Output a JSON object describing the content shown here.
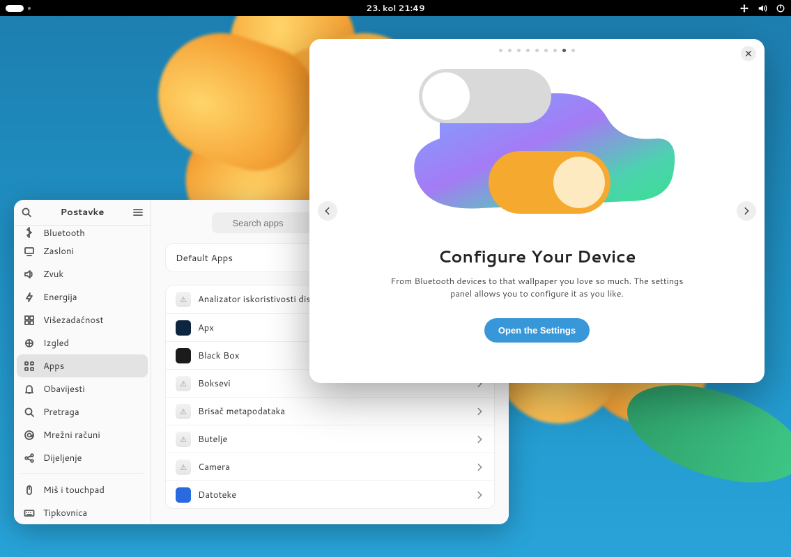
{
  "topbar": {
    "datetime": "23. kol  21:49"
  },
  "settings": {
    "title": "Postavke",
    "search_placeholder": "Search apps",
    "sidebar": {
      "items": [
        {
          "label": "Bluetooth",
          "icon": "bluetooth",
          "half": true
        },
        {
          "label": "Zasloni",
          "icon": "display"
        },
        {
          "label": "Zvuk",
          "icon": "sound"
        },
        {
          "label": "Energija",
          "icon": "power"
        },
        {
          "label": "Višezadaćnost",
          "icon": "multitask"
        },
        {
          "label": "Izgled",
          "icon": "appearance"
        },
        {
          "label": "Apps",
          "icon": "apps",
          "selected": true
        },
        {
          "label": "Obavijesti",
          "icon": "bell"
        },
        {
          "label": "Pretraga",
          "icon": "search"
        },
        {
          "label": "Mrežni računi",
          "icon": "at"
        },
        {
          "label": "Dijeljenje",
          "icon": "share"
        },
        {
          "separator": true
        },
        {
          "label": "Miš i touchpad",
          "icon": "mouse"
        },
        {
          "label": "Tipkovnica",
          "icon": "keyboard"
        }
      ]
    },
    "default_apps_label": "Default Apps",
    "apps": [
      {
        "name": "Analizator iskoristivosti diska",
        "icon": "generic"
      },
      {
        "name": "Apx",
        "icon": "term"
      },
      {
        "name": "Black Box",
        "icon": "dark"
      },
      {
        "name": "Boksevi",
        "icon": "generic"
      },
      {
        "name": "Brisač metapodataka",
        "icon": "generic"
      },
      {
        "name": "Butelje",
        "icon": "generic"
      },
      {
        "name": "Camera",
        "icon": "generic"
      },
      {
        "name": "Datoteke",
        "icon": "blue"
      }
    ]
  },
  "onboarding": {
    "title": "Configure Your Device",
    "description": "From Bluetooth devices to that wallpaper you love so much. The settings panel allows you to configure it as you like.",
    "button": "Open the Settings",
    "page_index": 7,
    "page_count": 9
  }
}
